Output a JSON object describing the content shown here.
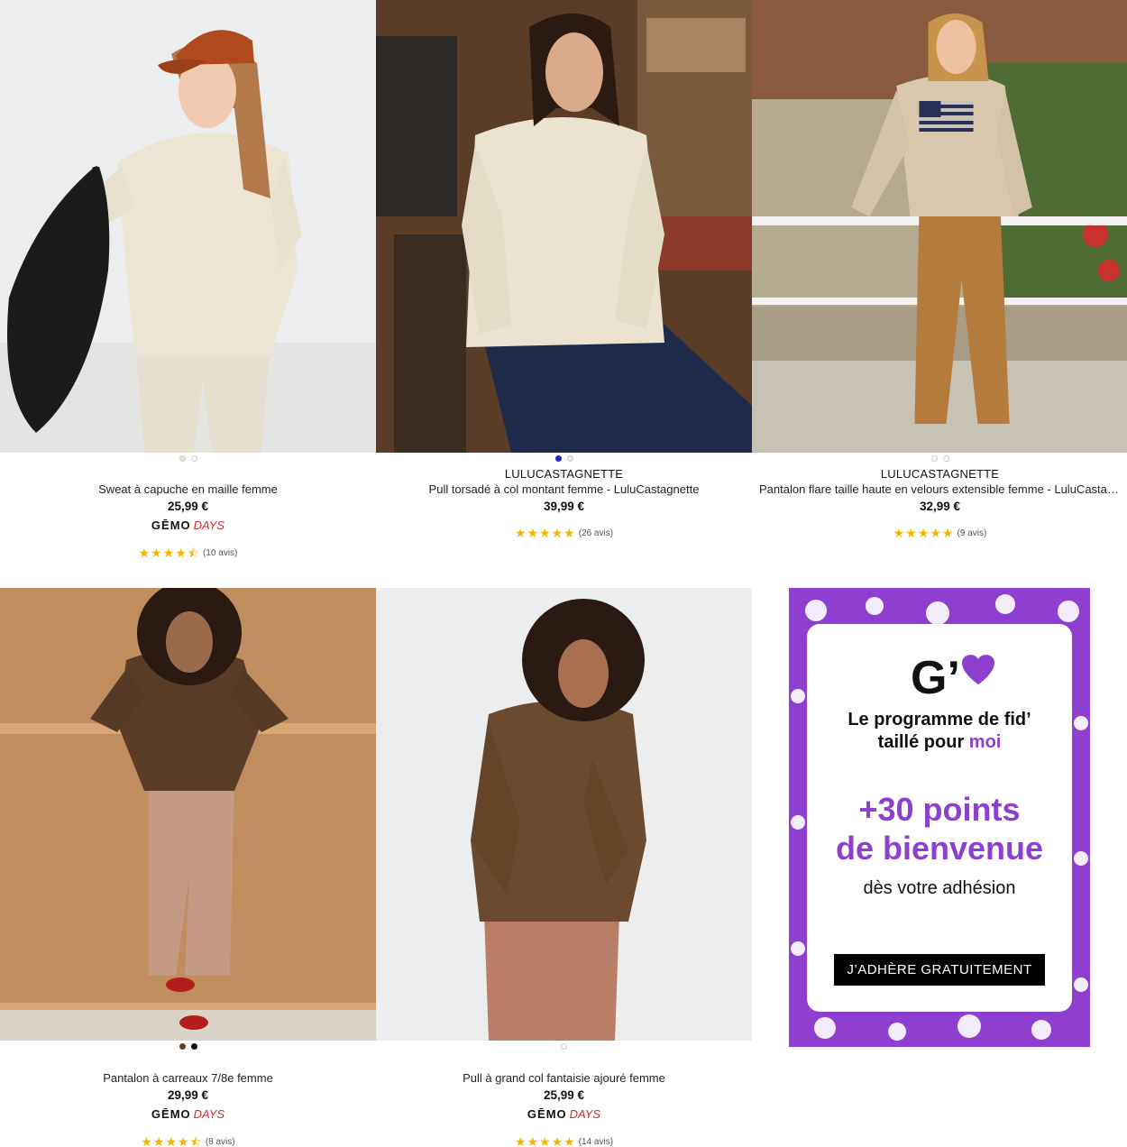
{
  "products": [
    {
      "brand": "",
      "name": "Sweat à capuche en maille femme",
      "price": "25,99 €",
      "gemo_word": "GĒMO",
      "gemo_days": "DAYS",
      "stars": "★★★★⯪",
      "reviews": "(10 avis)",
      "swatches": [
        "#efe7d2",
        "#ffffff"
      ],
      "image_icon": "woman-cream-hoodie-photo"
    },
    {
      "brand": "LULUCASTAGNETTE",
      "name": "Pull torsadé à col montant femme - LuluCastagnette",
      "price": "39,99 €",
      "stars": "★★★★★",
      "reviews": "(26 avis)",
      "swatches": [
        "#1a2bd6",
        "#f1ead6"
      ],
      "image_icon": "woman-cable-sweater-photo"
    },
    {
      "brand": "LULUCASTAGNETTE",
      "name": "Pantalon flare taille haute en velours extensible femme - LuluCastagnette",
      "price": "32,99 €",
      "stars": "★★★★★",
      "reviews": "(9 avis)",
      "swatches": [
        "#ffffff",
        "#ffffff"
      ],
      "image_icon": "woman-flare-trousers-photo"
    },
    {
      "brand": "",
      "name": "Pantalon à carreaux 7/8e femme",
      "price": "29,99 €",
      "gemo_word": "GĒMO",
      "gemo_days": "DAYS",
      "stars": "★★★★⯪",
      "reviews": "(8 avis)",
      "swatches": [
        "#6b3a18",
        "#111111"
      ],
      "image_icon": "woman-checked-trousers-photo"
    },
    {
      "brand": "",
      "name": "Pull à grand col fantaisie ajouré femme",
      "price": "25,99 €",
      "gemo_word": "GĒMO",
      "gemo_days": "DAYS",
      "stars": "★★★★★",
      "reviews": "(14 avis)",
      "swatches": [
        "#ffffff"
      ],
      "image_icon": "woman-brown-collar-sweater-photo"
    }
  ],
  "promo": {
    "logo_text": "G’",
    "line1": "Le programme de fid’",
    "line2_start": "taillé pour ",
    "line2_accent": "moi",
    "points": "+30 points",
    "welcome": "de bienvenue",
    "sub": "dès votre adhésion",
    "button": "J’ADHÈRE GRATUITEMENT",
    "accent_color": "#8e3fcf"
  }
}
